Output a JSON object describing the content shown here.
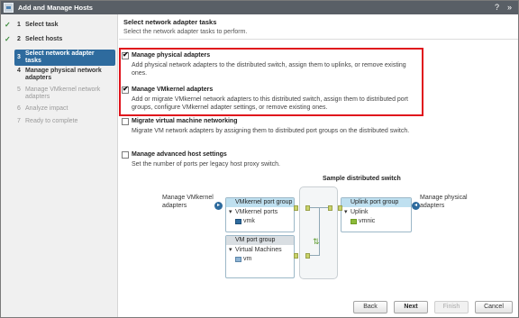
{
  "window": {
    "title": "Add and Manage Hosts"
  },
  "steps": [
    {
      "num": "1",
      "label": "Select task",
      "state": "done"
    },
    {
      "num": "2",
      "label": "Select hosts",
      "state": "done"
    },
    {
      "num": "3",
      "label": "Select network adapter tasks",
      "state": "active"
    },
    {
      "num": "4",
      "label": "Manage physical network adapters",
      "state": "pending"
    },
    {
      "num": "5",
      "label": "Manage VMkernel network adapters",
      "state": "disabled"
    },
    {
      "num": "6",
      "label": "Analyze impact",
      "state": "disabled"
    },
    {
      "num": "7",
      "label": "Ready to complete",
      "state": "disabled"
    }
  ],
  "main": {
    "heading": "Select network adapter tasks",
    "subheading": "Select the network adapter tasks to perform.",
    "options": [
      {
        "title": "Manage physical adapters",
        "checked": true,
        "desc": "Add physical network adapters to the distributed switch, assign them to uplinks, or remove existing ones."
      },
      {
        "title": "Manage VMkernel adapters",
        "checked": true,
        "desc": "Add or migrate VMkernel network adapters to this distributed switch, assign them to distributed port groups, configure VMkernel adapter settings, or remove existing ones."
      },
      {
        "title": "Migrate virtual machine networking",
        "checked": false,
        "desc": "Migrate VM network adapters by assigning them to distributed port groups on the distributed switch."
      },
      {
        "title": "Manage advanced host settings",
        "checked": false,
        "desc": "Set the number of ports per legacy host proxy switch."
      }
    ]
  },
  "diagram": {
    "title": "Sample distributed switch",
    "left_label": "Manage VMkernel adapters",
    "right_label": "Manage physical adapters",
    "vmk_group": {
      "header": "VMkernel port group",
      "ports_label": "VMkernel ports",
      "port": "vmk"
    },
    "vm_group": {
      "header": "VM port group",
      "vms_label": "Virtual Machines",
      "vm": "vm"
    },
    "uplink_group": {
      "header": "Uplink port group",
      "uplink_label": "Uplink",
      "nic": "vmnic"
    }
  },
  "footer": {
    "back": "Back",
    "next": "Next",
    "finish": "Finish",
    "cancel": "Cancel"
  },
  "colors": {
    "accent": "#2e6b9e",
    "highlight": "#e0141c",
    "titlebar": "#595f66"
  }
}
